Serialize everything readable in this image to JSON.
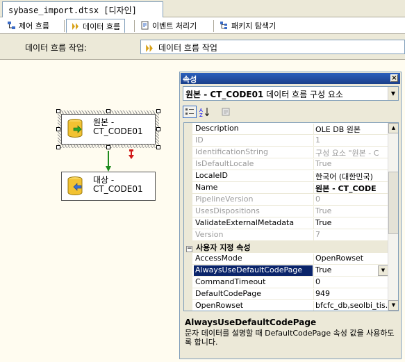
{
  "document": {
    "tab_title": "sybase_import.dtsx [디자인]"
  },
  "designer_tabs": [
    {
      "label": "제어 흐름",
      "icon": "control-flow-icon",
      "active": false
    },
    {
      "label": "데이터 흐름",
      "icon": "data-flow-icon",
      "active": true
    },
    {
      "label": "이벤트 처리기",
      "icon": "event-handler-icon",
      "active": false
    },
    {
      "label": "패키지 탐색기",
      "icon": "package-explorer-icon",
      "active": false
    }
  ],
  "task_bar": {
    "label": "데이터 흐름 작업:",
    "selected": "데이터 흐름 작업"
  },
  "canvas": {
    "source": {
      "label": "원본 -\nCT_CODE01"
    },
    "destination": {
      "label": "대상 -\nCT_CODE01"
    }
  },
  "properties": {
    "title": "속성",
    "close_glyph": "×",
    "object_name": "원본 - CT_CODE01",
    "object_type": "데이터 흐름 구성 요소",
    "rows": [
      {
        "name": "Description",
        "value": "OLE DB 원본",
        "disabled": false
      },
      {
        "name": "ID",
        "value": "1",
        "disabled": true
      },
      {
        "name": "IdentificationString",
        "value": "구성 요소 \"원본 - C",
        "disabled": true
      },
      {
        "name": "IsDefaultLocale",
        "value": "True",
        "disabled": true
      },
      {
        "name": "LocaleID",
        "value": "한국어 (대한민국)",
        "disabled": false
      },
      {
        "name": "Name",
        "value": "원본 - CT_CODE",
        "disabled": false,
        "bold": true
      },
      {
        "name": "PipelineVersion",
        "value": "0",
        "disabled": true
      },
      {
        "name": "UsesDispositions",
        "value": "True",
        "disabled": true
      },
      {
        "name": "ValidateExternalMetadata",
        "value": "True",
        "disabled": false
      },
      {
        "name": "Version",
        "value": "7",
        "disabled": true
      }
    ],
    "category": {
      "label": "사용자 지정 속성",
      "toggle": "−"
    },
    "custom_rows": [
      {
        "name": "AccessMode",
        "value": "OpenRowset"
      },
      {
        "name": "AlwaysUseDefaultCodePage",
        "value": "True",
        "selected": true
      },
      {
        "name": "CommandTimeout",
        "value": "0"
      },
      {
        "name": "DefaultCodePage",
        "value": "949"
      },
      {
        "name": "OpenRowset",
        "value": "bfcfc_db,seolbi_tis."
      }
    ],
    "description_title": "AlwaysUseDefaultCodePage",
    "description_text": "문자 데이터를 설명할 때 DefaultCodePage 속성 값을 사용하도록 합니다."
  }
}
